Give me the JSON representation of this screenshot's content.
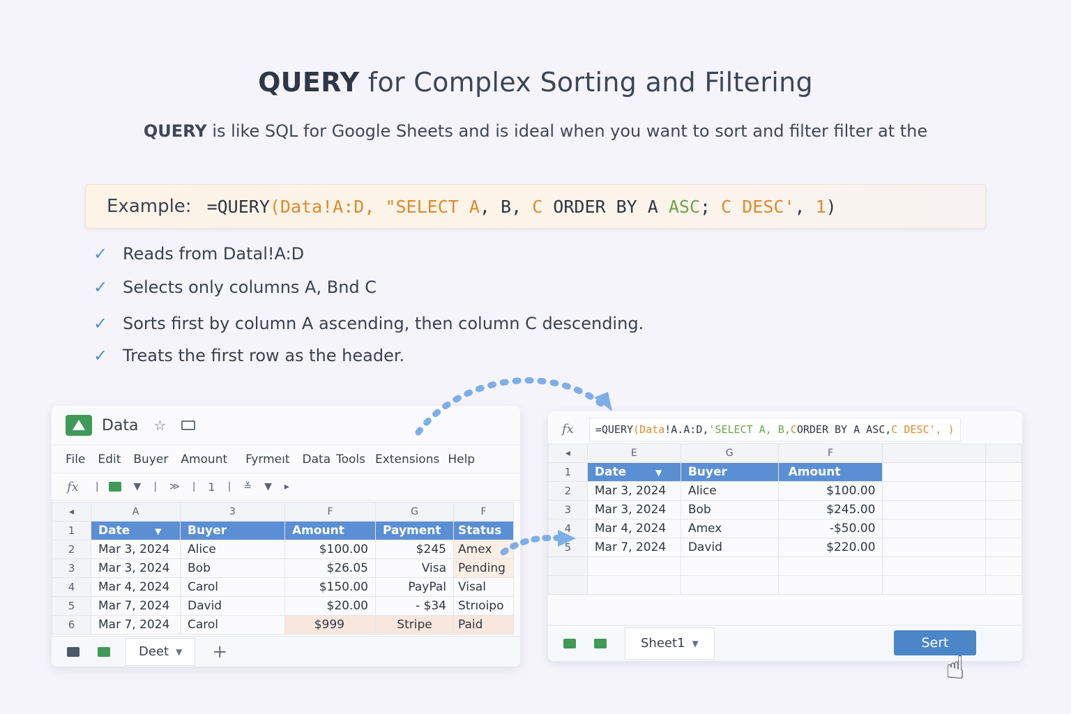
{
  "heading": {
    "bold": "QUERY",
    "rest": " for Complex Sorting and Filtering"
  },
  "subtitle": {
    "bold": "QUERY",
    "rest": " is like SQL for Google Sheets and is ideal when you want to sort and filter filter at the"
  },
  "example": {
    "label": "Example:",
    "code_parts": [
      {
        "text": "=QUERY",
        "color": "#2f3542"
      },
      {
        "text": "(Data!A:D, ",
        "color": "#e08a2c"
      },
      {
        "text": "\"SELECT A",
        "color": "#e08a2c"
      },
      {
        "text": ", B, ",
        "color": "#2f3542"
      },
      {
        "text": "C",
        "color": "#e08a2c"
      },
      {
        "text": " ORDER BY A ",
        "color": "#2f3542"
      },
      {
        "text": "ASC",
        "color": "#6ea24a"
      },
      {
        "text": "; ",
        "color": "#2f3542"
      },
      {
        "text": "C DESC'",
        "color": "#e08a2c"
      },
      {
        "text": ", ",
        "color": "#2f3542"
      },
      {
        "text": "1",
        "color": "#e08a2c"
      },
      {
        "text": ")",
        "color": "#2f3542"
      }
    ]
  },
  "checklist": [
    "Reads from Datal!A:D",
    "Selects only columns A, Bnd C",
    "Sorts first by column A ascending, then column C descending.",
    "Treats the first row as the header."
  ],
  "left_sheet": {
    "title": "Data",
    "menu": [
      "File",
      "Edit",
      "Buyer",
      "Amount",
      "Fyrmeıt",
      "Data",
      "Tools",
      "Extensions",
      "Help"
    ],
    "toolbar": {
      "fx": "fx",
      "num": "1"
    },
    "col_letters": [
      "A",
      "3",
      "F",
      "G",
      "F"
    ],
    "headers": [
      "Date",
      "Buyer",
      "Amount",
      "Payment",
      "Status"
    ],
    "rows": [
      [
        "Mar 3, 2024",
        "Alice",
        "$100.00",
        "$245",
        "Amex"
      ],
      [
        "Mar 3, 2024",
        "Bob",
        "$26.05",
        "Visa",
        "Pending"
      ],
      [
        "Mar 4, 2024",
        "Carol",
        "$150.00",
        "PayPal",
        "Visal"
      ],
      [
        "Mar 7, 2024",
        "David",
        "$20.00",
        "- $34",
        "Strıoipo"
      ],
      [
        "Mar 7, 2024",
        "Carol",
        "$999",
        "Stripe",
        "Paid"
      ]
    ],
    "row_numbers": [
      "1",
      "2",
      "3",
      "4",
      "5",
      "6"
    ],
    "tab": "Deet",
    "add_tab": "+"
  },
  "right_sheet": {
    "fx": "fx",
    "formula_parts": [
      {
        "text": "=QUERY",
        "color": "#2f3542"
      },
      {
        "text": "(Data",
        "color": "#e08a2c"
      },
      {
        "text": "!A.A:D, ",
        "color": "#2f3542"
      },
      {
        "text": "'SELECT A, B, ",
        "color": "#6ea24a"
      },
      {
        "text": "C",
        "color": "#e08a2c"
      },
      {
        "text": " ORDER BY A ASC, ",
        "color": "#2f3542"
      },
      {
        "text": "C DESC",
        "color": "#e08a2c"
      },
      {
        "text": "', )",
        "color": "#e08a2c"
      }
    ],
    "col_letters": [
      "E",
      "G",
      "F"
    ],
    "headers": [
      "Date",
      "Buyer",
      "Amount"
    ],
    "rows": [
      [
        "Mar 3, 2024",
        "Alice",
        "$100.00"
      ],
      [
        "Mar 3, 2024",
        "Bob",
        "$245.00"
      ],
      [
        "Mar 4, 2024",
        "Amex",
        "-$50.00"
      ],
      [
        "Mar 7, 2024",
        "David",
        "$220.00"
      ]
    ],
    "row_numbers": [
      "1",
      "2",
      "3",
      "4",
      "5"
    ],
    "tab": "Sheet1",
    "sort_button": "Sert"
  },
  "colors": {
    "header_blue": "#5b8fd4",
    "accent_green": "#3f9a57",
    "button_blue": "#4a86c8",
    "check_blue": "#4f8fd6"
  }
}
